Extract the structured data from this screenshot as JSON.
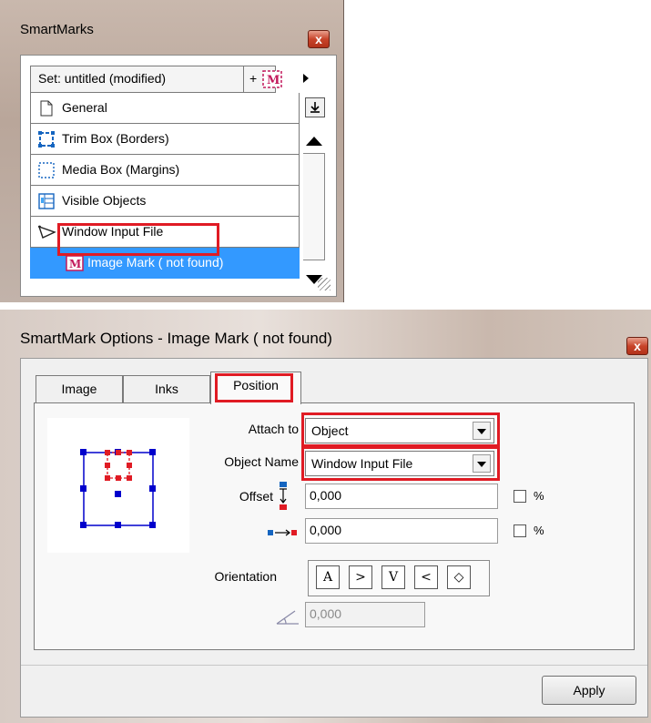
{
  "smartmarks": {
    "title": "SmartMarks",
    "close_glyph": "x",
    "set_label": "Set: untitled (modified)",
    "add_glyph": "+",
    "items": [
      {
        "label": "General",
        "icon": "page-icon"
      },
      {
        "label": "Trim Box (Borders)",
        "icon": "trim-box-icon"
      },
      {
        "label": "Media Box (Margins)",
        "icon": "media-box-icon"
      },
      {
        "label": "Visible Objects",
        "icon": "visible-objects-icon"
      },
      {
        "label": "Window Input File",
        "icon": "window-input-file-icon"
      },
      {
        "label": "Image Mark ( not found)",
        "icon": "image-mark-icon",
        "selected": true
      }
    ]
  },
  "options": {
    "title": "SmartMark Options - Image Mark ( not found)",
    "close_glyph": "x",
    "tabs": [
      "Image",
      "Inks",
      "Position"
    ],
    "active_tab": "Position",
    "attach_to_label": "Attach to",
    "attach_to_value": "Object",
    "object_name_label": "Object Name",
    "object_name_value": "Window Input File",
    "offset_label": "Offset",
    "offset_vertical": "0,000",
    "offset_horizontal": "0,000",
    "percent_label": "%",
    "orientation_label": "Orientation",
    "orientation_buttons": [
      "A",
      ">",
      "V",
      "<",
      "◇"
    ],
    "angle_value": "0,000",
    "apply_label": "Apply"
  },
  "colors": {
    "selection": "#3399ff",
    "highlight": "#e01b24",
    "preview_blue": "#0000cc",
    "preview_red": "#e01b24"
  }
}
